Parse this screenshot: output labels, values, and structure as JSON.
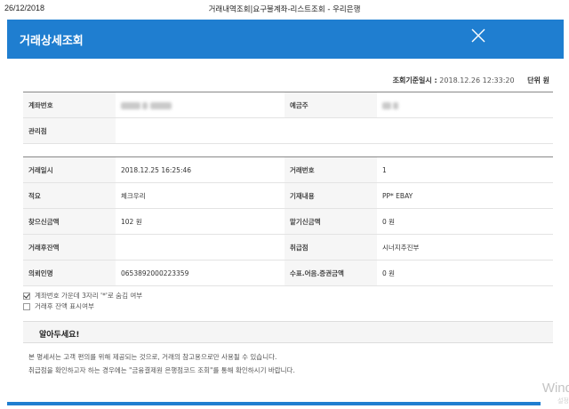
{
  "print": {
    "date": "26/12/2018",
    "title": "거래내역조회|요구불계좌-리스트조회 - 우리은행"
  },
  "popup": {
    "title": "거래상세조회"
  },
  "reference": {
    "label": "조회기준일시 :",
    "datetime": "2018.12.26 12:33:20",
    "unit": "단위 원"
  },
  "account_table": [
    {
      "label": "계좌번호",
      "value": "",
      "label2": "예금주",
      "value2": ""
    },
    {
      "label": "관리점",
      "value": ""
    }
  ],
  "transaction_table": [
    {
      "label": "거래일시",
      "value": "2018.12.25 16:25:46",
      "label2": "거래번호",
      "value2": "1"
    },
    {
      "label": "적요",
      "value": "체크우리",
      "label2": "기재내용",
      "value2": "PP* EBAY"
    },
    {
      "label": "찾으신금액",
      "value": "102 원",
      "label2": "맡기신금액",
      "value2": "0 원"
    },
    {
      "label": "거래후잔액",
      "value": "",
      "label2": "취급점",
      "value2": "시너지추진부"
    },
    {
      "label": "의뢰인명",
      "value": "0653892000223359",
      "label2": "수표.어음.증권금액",
      "value2": "0 원"
    }
  ],
  "options": [
    {
      "label": "계좌번호 가운데 3자리 '*'로 숨김 여부",
      "checked": true
    },
    {
      "label": "거래후 잔액 표시여부",
      "checked": false
    }
  ],
  "notice": {
    "title": "알아두세요!",
    "lines": [
      "본 명세서는 고객 편의를 위해 제공되는 것으로, 거래의 참고용으로만 사용될 수 있습니다.",
      "취급점을 확인하고자 하는 경우에는 \"금융결제원 은행점코드 조회\"를 통해 확인하시기 바랍니다."
    ]
  },
  "watermark": {
    "text": "Wind",
    "sub": "설정"
  }
}
